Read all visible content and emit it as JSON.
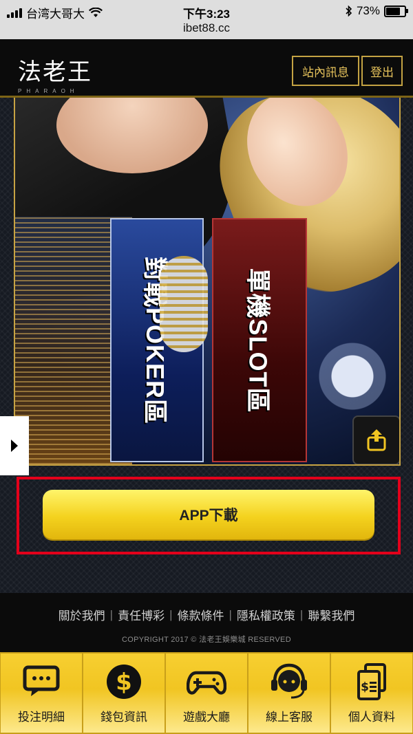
{
  "status_bar": {
    "carrier": "台湾大哥大",
    "time": "下午3:23",
    "url": "ibet88.cc",
    "battery": "73%",
    "battery_level": 0.73
  },
  "header": {
    "logo_cn": "法老王",
    "logo_en": "PHARAOH",
    "messages_label": "站內訊息",
    "logout_label": "登出"
  },
  "banner": {
    "poker_label": "對戰POKER區",
    "slot_label": "單機SLOT區"
  },
  "app_download_label": "APP下載",
  "footer": {
    "links": [
      "關於我們",
      "責任博彩",
      "條款條件",
      "隱私權政策",
      "聯繫我們"
    ],
    "copyright": "COPYRIGHT 2017 © 法老王娛樂城 RESERVED"
  },
  "tabbar": [
    {
      "label": "投注明細",
      "icon": "chat-bubble-icon"
    },
    {
      "label": "錢包資訊",
      "icon": "dollar-coin-icon"
    },
    {
      "label": "遊戲大廳",
      "icon": "gamepad-icon"
    },
    {
      "label": "線上客服",
      "icon": "headset-support-icon"
    },
    {
      "label": "個人資料",
      "icon": "document-dollar-icon"
    }
  ],
  "colors": {
    "gold": "#c7a343",
    "button_yellow": "#f4d21e",
    "highlight_red": "#e3001b"
  }
}
